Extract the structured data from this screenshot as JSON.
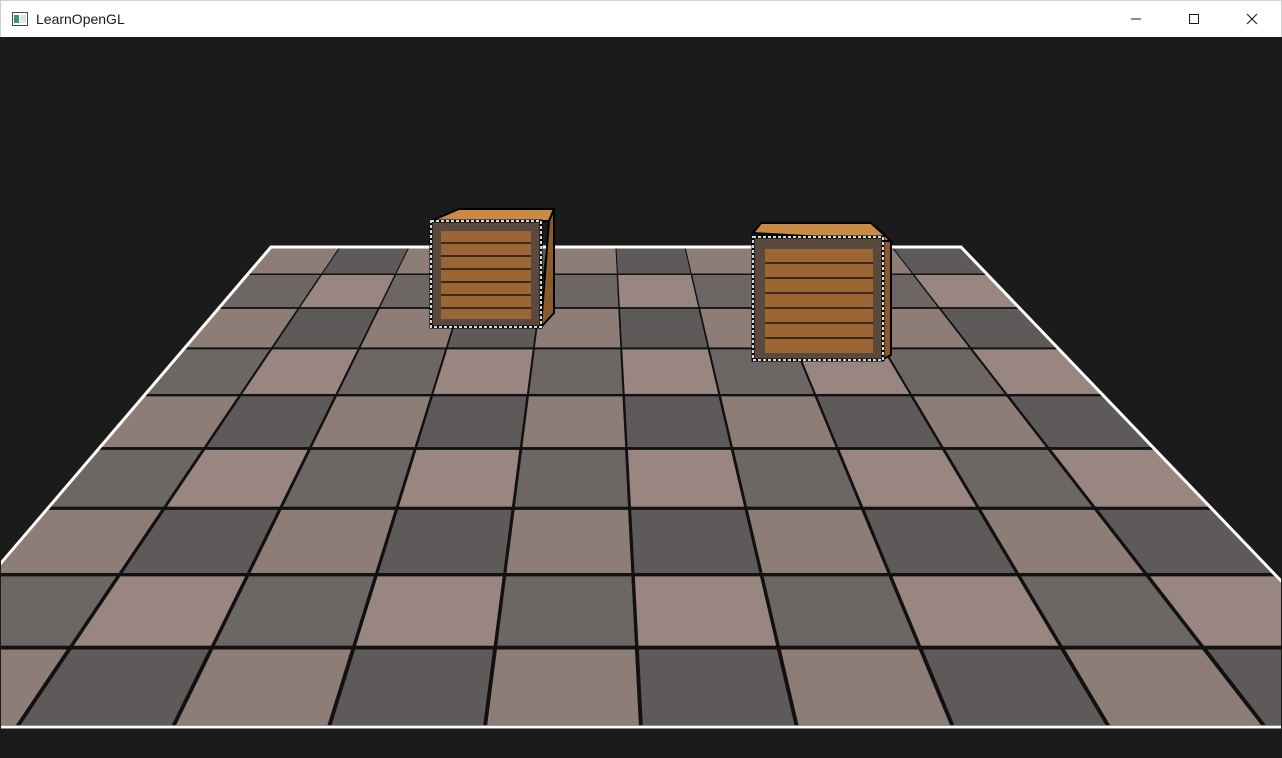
{
  "window": {
    "title": "LearnOpenGL",
    "controls": {
      "minimize_icon": "minimize-icon",
      "maximize_icon": "maximize-icon",
      "close_icon": "close-icon"
    }
  },
  "scene": {
    "background_color": "#1b1b1b",
    "floor_colors": [
      "#9a8680",
      "#5d5a59",
      "#8e7c77",
      "#6c6664"
    ],
    "crate_colors": [
      "#8b5a2b",
      "#c98a45",
      "#3a2a1a"
    ],
    "objects": [
      "floor",
      "crate",
      "crate"
    ]
  }
}
